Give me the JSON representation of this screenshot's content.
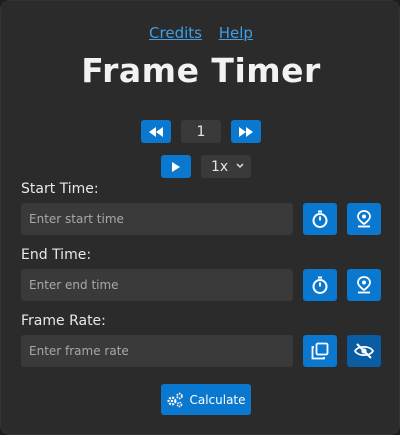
{
  "header": {
    "links": [
      {
        "label": "Credits"
      },
      {
        "label": "Help"
      }
    ],
    "title": "Frame Timer"
  },
  "playback": {
    "frame_value": "1",
    "speed_selected": "1x"
  },
  "fields": [
    {
      "label": "Start Time:",
      "placeholder": "Enter start time",
      "icons": [
        "stopwatch-icon",
        "location-pin-icon"
      ]
    },
    {
      "label": "End Time:",
      "placeholder": "Enter end time",
      "icons": [
        "stopwatch-icon",
        "location-pin-icon"
      ]
    },
    {
      "label": "Frame Rate:",
      "placeholder": "Enter frame rate",
      "icons": [
        "copy-icon",
        "eye-off-icon"
      ]
    }
  ],
  "actions": {
    "calculate_label": "Calculate"
  },
  "colors": {
    "accent": "#0b78d0",
    "accent_dark": "#0b5da3",
    "link": "#3f9fe8",
    "panel": "#2b2b2b",
    "input_bg": "#3a3a3a"
  }
}
